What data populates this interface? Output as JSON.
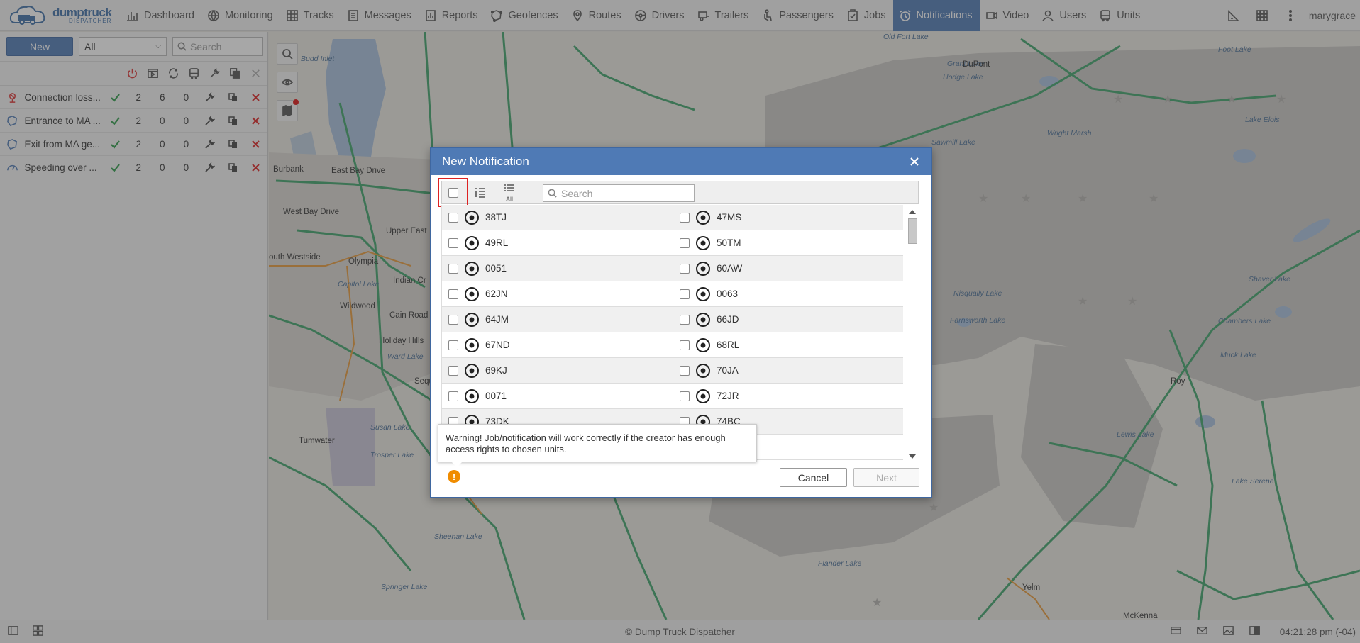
{
  "app": {
    "logo_text": "dumptruck",
    "logo_sub": "DISPATCHER",
    "username": "marygrace"
  },
  "nav": [
    {
      "label": "Dashboard",
      "icon": "bar-chart-icon"
    },
    {
      "label": "Monitoring",
      "icon": "globe-icon"
    },
    {
      "label": "Tracks",
      "icon": "map-grid-icon"
    },
    {
      "label": "Messages",
      "icon": "document-icon"
    },
    {
      "label": "Reports",
      "icon": "report-icon"
    },
    {
      "label": "Geofences",
      "icon": "geofence-icon"
    },
    {
      "label": "Routes",
      "icon": "route-icon"
    },
    {
      "label": "Drivers",
      "icon": "steering-wheel-icon"
    },
    {
      "label": "Trailers",
      "icon": "trailer-icon"
    },
    {
      "label": "Passengers",
      "icon": "passenger-icon"
    },
    {
      "label": "Jobs",
      "icon": "clipboard-check-icon"
    },
    {
      "label": "Notifications",
      "icon": "alarm-clock-icon",
      "active": true
    },
    {
      "label": "Video",
      "icon": "video-camera-icon"
    },
    {
      "label": "Users",
      "icon": "user-icon"
    },
    {
      "label": "Units",
      "icon": "bus-icon"
    }
  ],
  "left_panel": {
    "new_button": "New",
    "filter_value": "All",
    "search_placeholder": "Search",
    "notifications": [
      {
        "name": "Connection loss...",
        "icon": "connection-loss-icon",
        "count_a": "2",
        "count_b": "6",
        "count_c": "0"
      },
      {
        "name": "Entrance to MA ...",
        "icon": "geofence-icon",
        "count_a": "2",
        "count_b": "0",
        "count_c": "0"
      },
      {
        "name": "Exit from MA ge...",
        "icon": "geofence-icon",
        "count_a": "2",
        "count_b": "0",
        "count_c": "0"
      },
      {
        "name": "Speeding over ...",
        "icon": "speedometer-icon",
        "count_a": "2",
        "count_b": "0",
        "count_c": "0"
      }
    ]
  },
  "map_labels": [
    {
      "text": "Budd Inlet",
      "kind": "water"
    },
    {
      "text": "Burbank",
      "kind": "town"
    },
    {
      "text": "East Bay Drive",
      "kind": "town"
    },
    {
      "text": "West Bay Drive",
      "kind": "town"
    },
    {
      "text": "Upper East",
      "kind": "town"
    },
    {
      "text": "outh Westside",
      "kind": "town"
    },
    {
      "text": "Olympia",
      "kind": "town"
    },
    {
      "text": "Capitol Lake",
      "kind": "water"
    },
    {
      "text": "Indian Cr",
      "kind": "town"
    },
    {
      "text": "Wildwood",
      "kind": "town"
    },
    {
      "text": "Cain Road",
      "kind": "town"
    },
    {
      "text": "Holiday Hills",
      "kind": "town"
    },
    {
      "text": "Ward Lake",
      "kind": "water"
    },
    {
      "text": "Sequ",
      "kind": "town"
    },
    {
      "text": "Susan Lake",
      "kind": "water"
    },
    {
      "text": "Tumwater",
      "kind": "town"
    },
    {
      "text": "Trosper Lake",
      "kind": "water"
    },
    {
      "text": "Sheehan Lake",
      "kind": "water"
    },
    {
      "text": "Springer Lake",
      "kind": "water"
    },
    {
      "text": "Old Fort Lake",
      "kind": "water"
    },
    {
      "text": "Grant Lake",
      "kind": "water"
    },
    {
      "text": "DuPont",
      "kind": "town"
    },
    {
      "text": "Hodge Lake",
      "kind": "water"
    },
    {
      "text": "Foot Lake",
      "kind": "water"
    },
    {
      "text": "Lake Elois",
      "kind": "water"
    },
    {
      "text": "Sawmill Lake",
      "kind": "water"
    },
    {
      "text": "Wright Marsh",
      "kind": "water"
    },
    {
      "text": "Nisqually Lake",
      "kind": "water"
    },
    {
      "text": "Farnsworth Lake",
      "kind": "water"
    },
    {
      "text": "Shaver Lake",
      "kind": "water"
    },
    {
      "text": "Chambers Lake",
      "kind": "water"
    },
    {
      "text": "Muck Lake",
      "kind": "water"
    },
    {
      "text": "Roy",
      "kind": "town"
    },
    {
      "text": "Lewis Lake",
      "kind": "water"
    },
    {
      "text": "Lake Serene",
      "kind": "water"
    },
    {
      "text": "Flander Lake",
      "kind": "water"
    },
    {
      "text": "Yelm",
      "kind": "town"
    },
    {
      "text": "McKenna",
      "kind": "town"
    }
  ],
  "modal": {
    "title": "New Notification",
    "search_placeholder": "Search",
    "all_label": "All",
    "units": [
      [
        "38TJ",
        "47MS"
      ],
      [
        "49RL",
        "50TM"
      ],
      [
        "0051",
        "60AW"
      ],
      [
        "62JN",
        "0063"
      ],
      [
        "64JM",
        "66JD"
      ],
      [
        "67ND",
        "68RL"
      ],
      [
        "69KJ",
        "70JA"
      ],
      [
        "0071",
        "72JR"
      ],
      [
        "73DK",
        "74BC"
      ],
      [
        "",
        ""
      ]
    ],
    "warning_text": "Warning! Job/notification will work correctly if the creator has enough access rights to chosen units.",
    "cancel_label": "Cancel",
    "next_label": "Next"
  },
  "footer": {
    "copyright": "© Dump Truck Dispatcher",
    "clock": "04:21:28 pm (-04)"
  }
}
